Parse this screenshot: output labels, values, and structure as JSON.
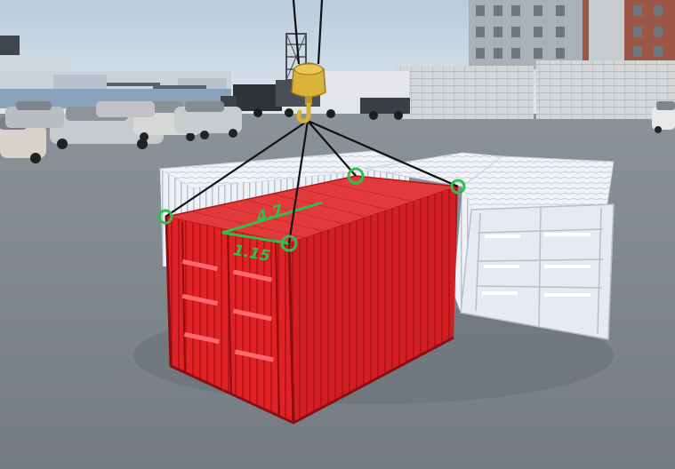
{
  "colors": {
    "sky": "#c9d7e2",
    "ground": "#7f868c",
    "selected_container": "#e8262b",
    "selected_container_dark": "#b5151a",
    "white_container": "#e9eef5",
    "rope": "#111111",
    "hook": "#d9b23a",
    "attach_marker": "#2fbf4f",
    "dimension": "#2fbf4f"
  },
  "icons": {
    "crane_hook": "crane-hook-icon",
    "attach_point": "attach-point-marker"
  },
  "measurements": {
    "length_label": "4.7",
    "width_label": "1.15"
  }
}
